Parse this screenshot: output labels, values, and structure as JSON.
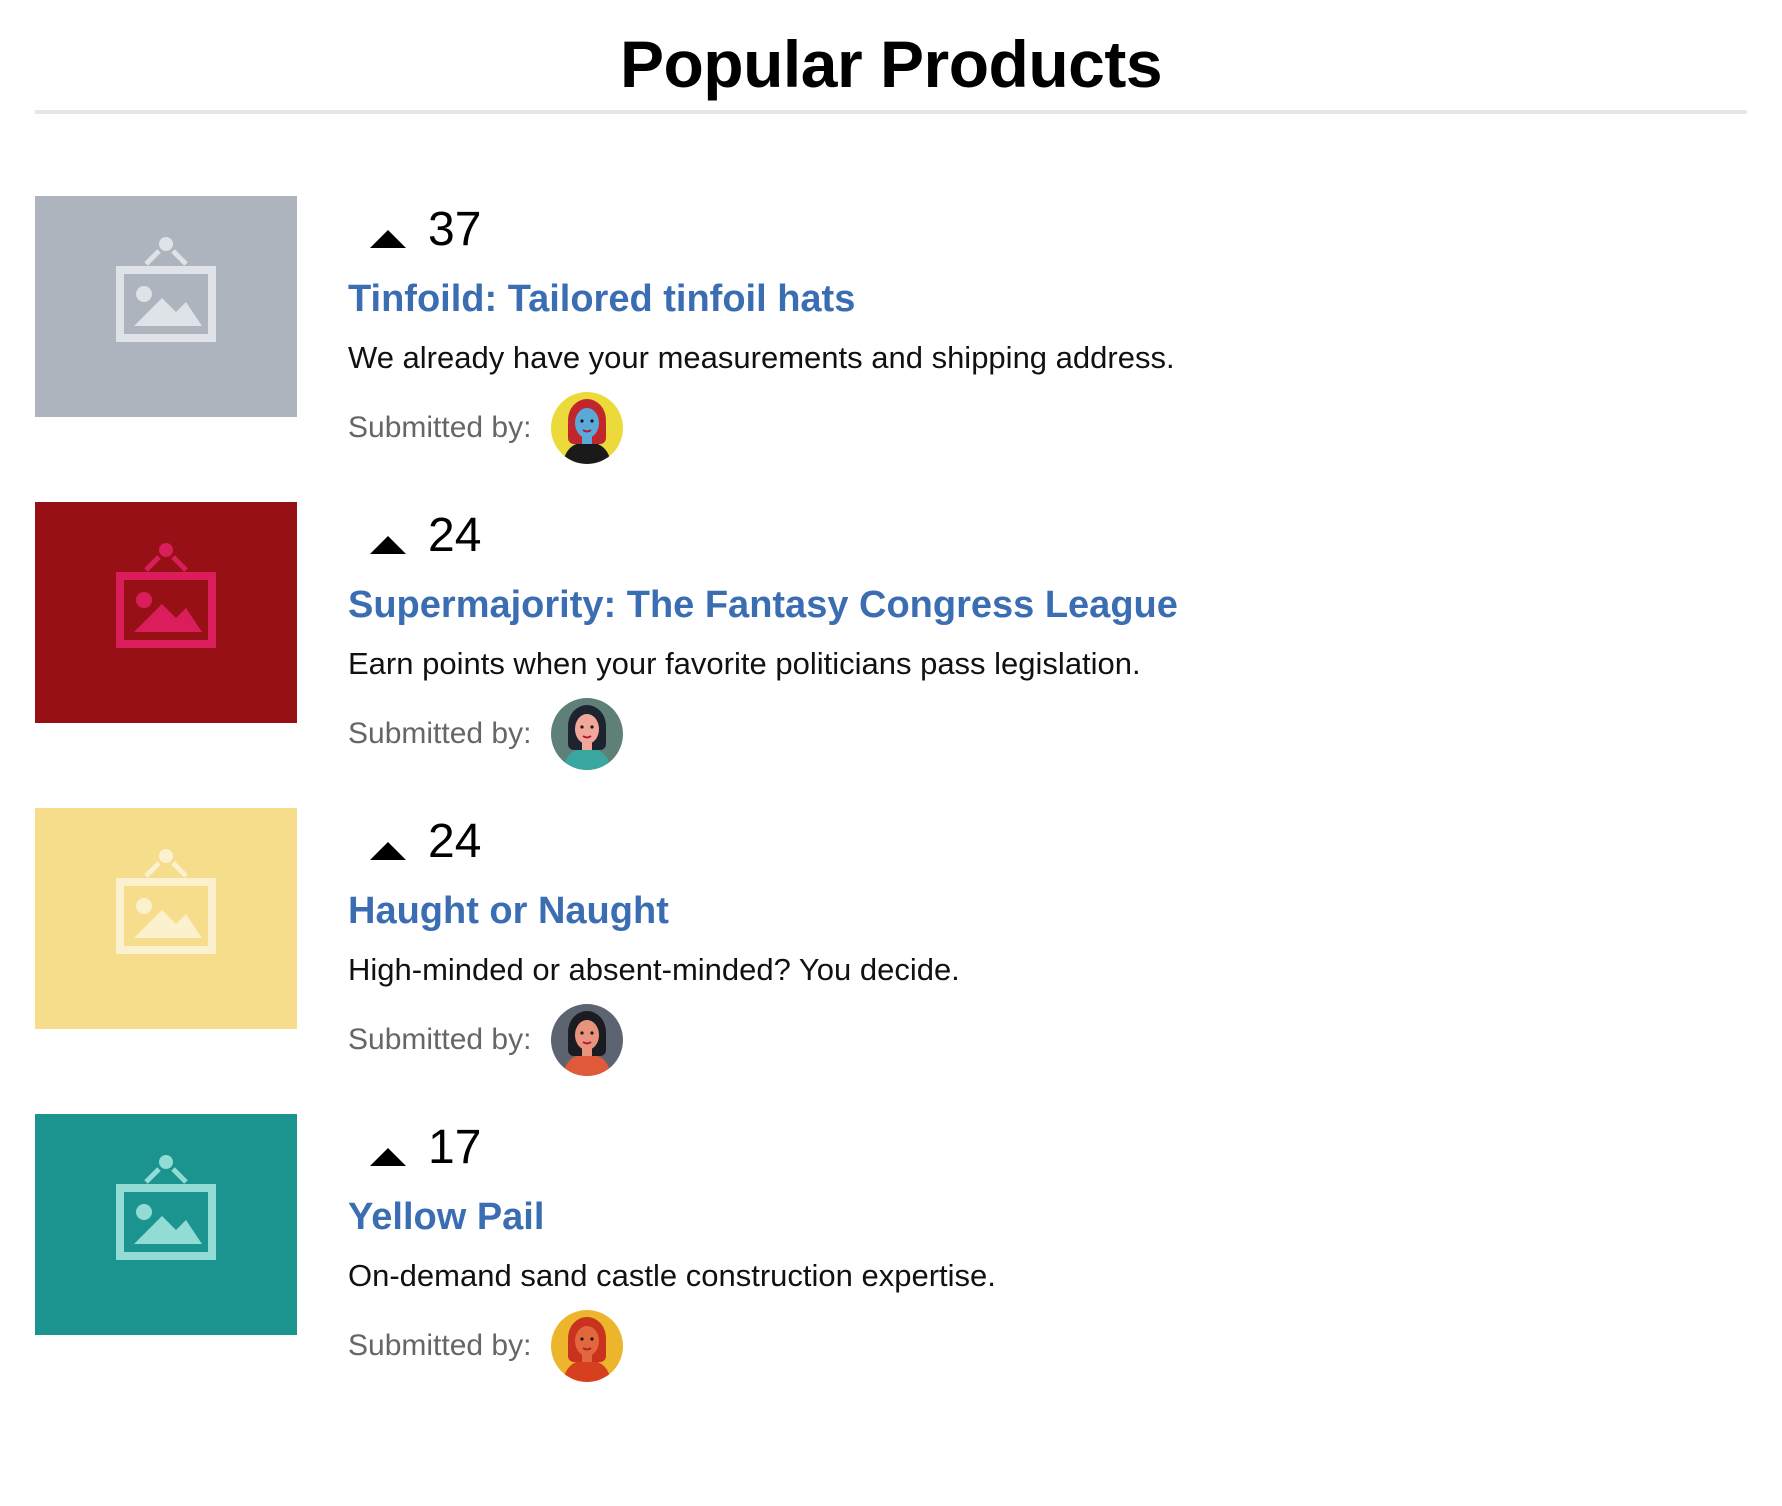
{
  "page": {
    "title": "Popular Products"
  },
  "submitted_label": "Submitted by:",
  "products": [
    {
      "votes": "37",
      "title": "Tinfoild: Tailored tinfoil hats",
      "description": "We already have your measurements and shipping address.",
      "thumb_bg": "#adb4bd",
      "thumb_icon_color": "#dfe3e8",
      "avatar_bg": "#ecd93a",
      "avatar_hair": "#c0262b",
      "avatar_face": "#5aa9d8",
      "avatar_body": "#1a1a1a"
    },
    {
      "votes": "24",
      "title": "Supermajority: The Fantasy Congress League",
      "description": "Earn points when your favorite politicians pass legislation.",
      "thumb_bg": "#961015",
      "thumb_icon_color": "#d91e5b",
      "avatar_bg": "#5f8078",
      "avatar_hair": "#1d2430",
      "avatar_face": "#f1a89a",
      "avatar_body": "#3aa6a0"
    },
    {
      "votes": "24",
      "title": "Haught or Naught",
      "description": "High-minded or absent-minded? You decide.",
      "thumb_bg": "#f5dd8c",
      "thumb_icon_color": "#fbf1cf",
      "avatar_bg": "#5b6470",
      "avatar_hair": "#1b1b22",
      "avatar_face": "#e8937e",
      "avatar_body": "#e05a3a"
    },
    {
      "votes": "17",
      "title": "Yellow Pail",
      "description": "On-demand sand castle construction expertise.",
      "thumb_bg": "#1b9490",
      "thumb_icon_color": "#93dbd5",
      "avatar_bg": "#edb52c",
      "avatar_hair": "#c8321e",
      "avatar_face": "#e2673c",
      "avatar_body": "#d6401f"
    }
  ]
}
